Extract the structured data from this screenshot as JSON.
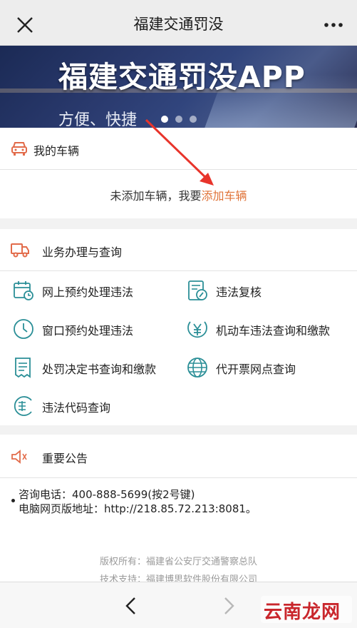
{
  "header": {
    "title": "福建交通罚没",
    "close_icon": "close-icon",
    "more_icon": "more-icon"
  },
  "banner": {
    "title": "福建交通罚没APP",
    "subtitle": "方便、快捷",
    "slides": 3,
    "active_slide": 1
  },
  "my_vehicle": {
    "title": "我的车辆",
    "icon": "car-icon",
    "empty_text": "未添加车辆，我要",
    "add_link": "添加车辆"
  },
  "services": {
    "title": "业务办理与查询",
    "icon": "truck-icon",
    "items": [
      {
        "label": "网上预约处理违法",
        "icon": "calendar-icon"
      },
      {
        "label": "违法复核",
        "icon": "review-icon"
      },
      {
        "label": "窗口预约处理违法",
        "icon": "clock-icon"
      },
      {
        "label": "机动车违法查询和缴款",
        "icon": "yen-icon"
      },
      {
        "label": "处罚决定书查询和缴款",
        "icon": "receipt-icon"
      },
      {
        "label": "代开票网点查询",
        "icon": "globe-icon"
      },
      {
        "label": "违法代码查询",
        "icon": "code-icon"
      }
    ]
  },
  "announcement": {
    "title": "重要公告",
    "icon": "speaker-icon",
    "lines": [
      "咨询电话：400-888-5699(按2号键)",
      "电脑网页版地址：http://218.85.72.213:8081。"
    ]
  },
  "footer": {
    "copyright": "版权所有：福建省公安厅交通警察总队",
    "support": "技术支持：福建博思软件股份有限公司"
  },
  "watermark": "云南龙网",
  "colors": {
    "accent": "#e0743a",
    "icon_teal": "#2b8f97",
    "icon_orange": "#e26b4a"
  }
}
